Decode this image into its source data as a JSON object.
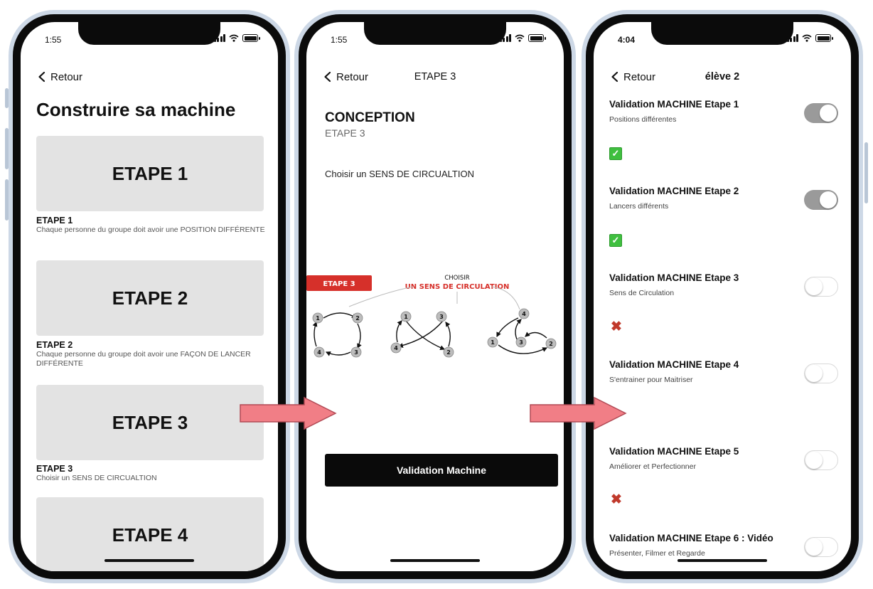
{
  "colors": {
    "arrow_fill": "#f17e86",
    "arrow_stroke": "#b14a55",
    "check_green": "#3fbf3f",
    "cross_red": "#c0392b",
    "toggle_on": "#9a9a9a",
    "card_gray": "#e3e3e3",
    "diagram_red": "#d6302a"
  },
  "screen1": {
    "status_time": "1:55",
    "back_label": "Retour",
    "title": "Construire sa machine",
    "steps": [
      {
        "card": "ETAPE 1",
        "label": "ETAPE 1",
        "desc": "Chaque personne du groupe doit avoir une POSITION DIFFÉRENTE"
      },
      {
        "card": "ETAPE 2",
        "label": "ETAPE 2",
        "desc": "Chaque personne du groupe doit avoir une FAÇON DE LANCER DIFFÉRENTE"
      },
      {
        "card": "ETAPE 3",
        "label": "ETAPE 3",
        "desc": "Choisir un SENS DE CIRCUALTION"
      },
      {
        "card": "ETAPE 4"
      }
    ]
  },
  "screen2": {
    "status_time": "1:55",
    "back_label": "Retour",
    "nav_title": "ETAPE 3",
    "heading": "CONCEPTION",
    "subheading": "ETAPE 3",
    "text": "Choisir un SENS DE CIRCUALTION",
    "diagram": {
      "badge": "ETAPE 3",
      "choose": "CHOISIR",
      "sens": "UN SENS DE CIRCULATION",
      "nodes": [
        "1",
        "2",
        "3",
        "4",
        "1",
        "2",
        "3",
        "4",
        "1",
        "2",
        "3",
        "4"
      ]
    },
    "button": "Validation Machine"
  },
  "screen3": {
    "status_time": "4:04",
    "back_label": "Retour",
    "nav_title": "élève 2",
    "rows": [
      {
        "title": "Validation MACHINE Etape 1",
        "sub": "Positions différentes",
        "on": true,
        "mark": "check"
      },
      {
        "title": "Validation MACHINE Etape 2",
        "sub": "Lancers différents",
        "on": true,
        "mark": "check"
      },
      {
        "title": "Validation MACHINE Etape 3",
        "sub": "Sens de Circulation",
        "on": false,
        "mark": "cross"
      },
      {
        "title": "Validation MACHINE Etape 4",
        "sub": "S'entrainer pour Maitriser",
        "on": false,
        "mark": "none"
      },
      {
        "title": "Validation MACHINE Etape 5",
        "sub": "Améliorer et Perfectionner",
        "on": false,
        "mark": "cross"
      },
      {
        "title": "Validation MACHINE Etape 6 : Vidéo",
        "sub": "Présenter, Filmer et Regarde",
        "on": false
      }
    ],
    "check_glyph": "✓",
    "cross_glyph": "✖"
  }
}
